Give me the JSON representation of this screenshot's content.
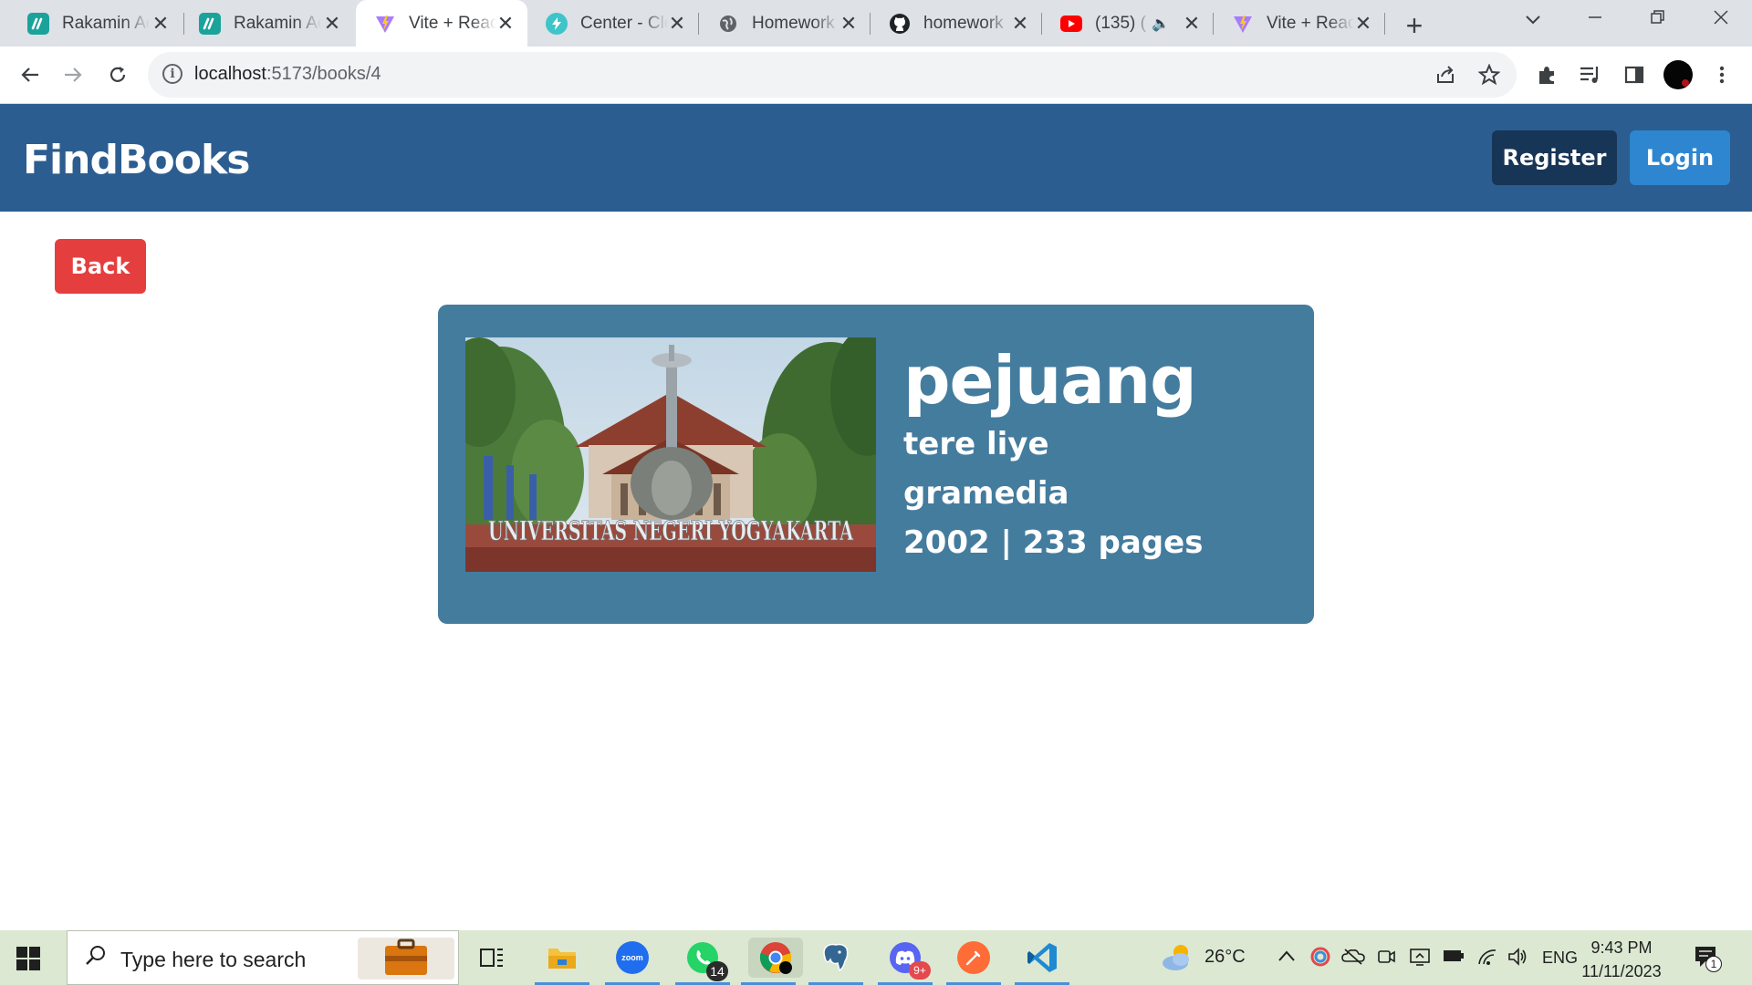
{
  "browser": {
    "tabs": [
      {
        "label": "Rakamin Academy",
        "icon": "rakamin-icon",
        "active": false
      },
      {
        "label": "Rakamin Academy",
        "icon": "rakamin-icon",
        "active": false
      },
      {
        "label": "Vite + React",
        "icon": "vite-icon",
        "active": true
      },
      {
        "label": "Center - Clear",
        "icon": "codeium-icon",
        "active": false
      },
      {
        "label": "Homework",
        "icon": "globe-icon",
        "active": false
      },
      {
        "label": "homework",
        "icon": "github-icon",
        "active": false
      },
      {
        "label": "(135) (",
        "icon": "youtube-icon",
        "active": false
      },
      {
        "label": "Vite + React",
        "icon": "vite-icon",
        "active": false
      }
    ],
    "url_host": "localhost",
    "url_path": ":5173/books/4"
  },
  "app": {
    "brand": "FindBooks",
    "register_label": "Register",
    "login_label": "Login",
    "back_label": "Back"
  },
  "book": {
    "title": "pejuang",
    "author": "tere liye",
    "publisher": "gramedia",
    "meta": "2002 | 233 pages",
    "cover_caption": "UNIVERSITAS NEGERI YOGYAKARTA"
  },
  "taskbar": {
    "search_placeholder": "Type here to search",
    "whatsapp_badge": "14",
    "discord_badge": "9+",
    "weather": "26°C",
    "language": "ENG",
    "time": "9:43 PM",
    "date": "11/11/2023",
    "notifications": "1"
  },
  "colors": {
    "header": "#2c5d90",
    "register": "#173556",
    "login": "#2e86d0",
    "back": "#e53e3e",
    "card": "#447c9e"
  }
}
